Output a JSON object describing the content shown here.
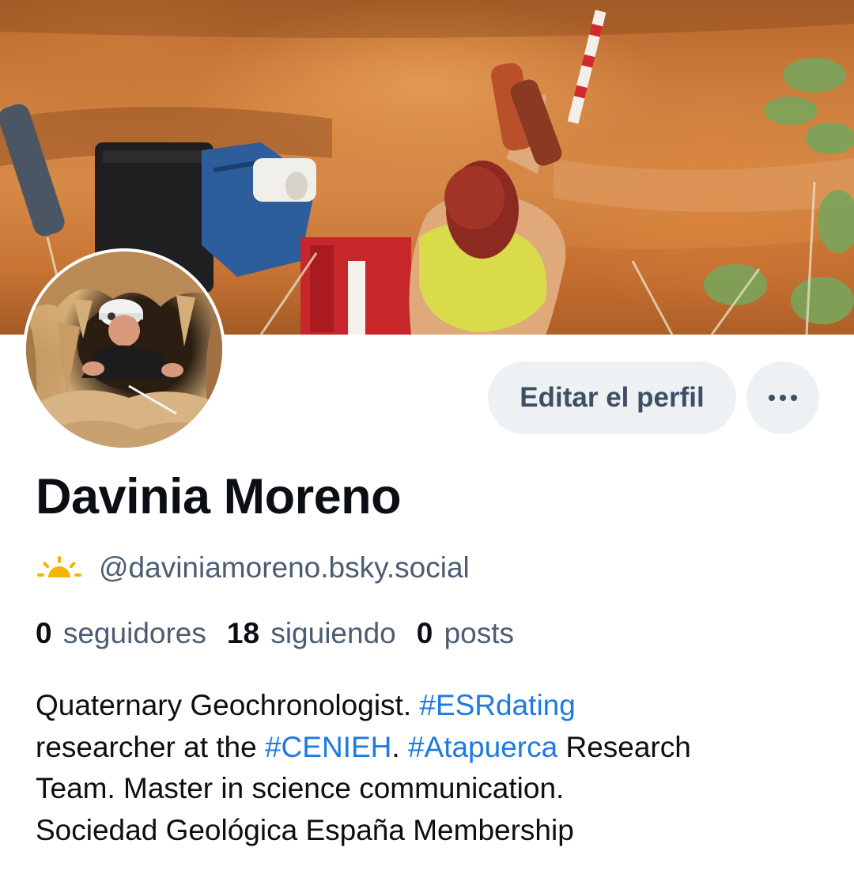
{
  "profile": {
    "display_name": "Davinia Moreno",
    "handle": "@daviniamoreno.bsky.social",
    "handle_icon": "sun-emoji-icon"
  },
  "actions": {
    "edit_label": "Editar el perfil",
    "more_icon": "more-horizontal-icon"
  },
  "stats": {
    "followers_count": "0",
    "followers_label": "seguidores",
    "following_count": "18",
    "following_label": "siguiendo",
    "posts_count": "0",
    "posts_label": "posts"
  },
  "bio": {
    "l1_text": "Quaternary Geochronologist. ",
    "l1_tag": "#ESRdating",
    "l2_text_a": "researcher at the ",
    "l2_tag_a": "#CENIEH",
    "l2_text_b": ". ",
    "l2_tag_b": "#Atapuerca",
    "l2_text_c": " Research",
    "l3_text": "Team. Master in science communication.",
    "l4_text": "Sociedad Geológica España Membership"
  },
  "colors": {
    "link": "#1d7ae0",
    "muted_text": "#4b5d72",
    "button_bg": "#eef1f4",
    "primary_text": "#0b0f14"
  }
}
